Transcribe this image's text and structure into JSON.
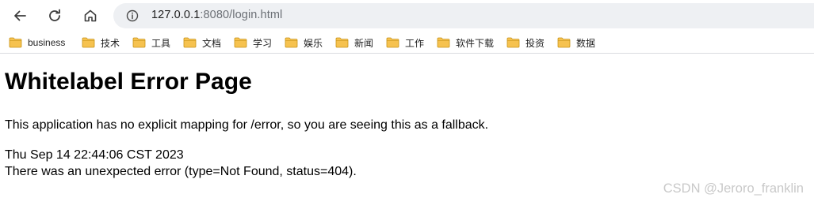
{
  "browser": {
    "url_host": "127.0.0.1",
    "url_rest": ":8080/login.html",
    "icons": {
      "back": "back-arrow-icon",
      "reload": "reload-icon",
      "home": "home-icon",
      "site_info": "info-icon"
    },
    "bookmarks": [
      {
        "label": "business"
      },
      {
        "label": "技术"
      },
      {
        "label": "工具"
      },
      {
        "label": "文档"
      },
      {
        "label": "学习"
      },
      {
        "label": "娱乐"
      },
      {
        "label": "新闻"
      },
      {
        "label": "工作"
      },
      {
        "label": "软件下载"
      },
      {
        "label": "投资"
      },
      {
        "label": "数据"
      }
    ],
    "folder_color": "#f6c24f"
  },
  "page": {
    "title": "Whitelabel Error Page",
    "message": "This application has no explicit mapping for /error, so you are seeing this as a fallback.",
    "timestamp": "Thu Sep 14 22:44:06 CST 2023",
    "error": "There was an unexpected error (type=Not Found, status=404)."
  },
  "watermark": "CSDN @Jeroro_franklin"
}
